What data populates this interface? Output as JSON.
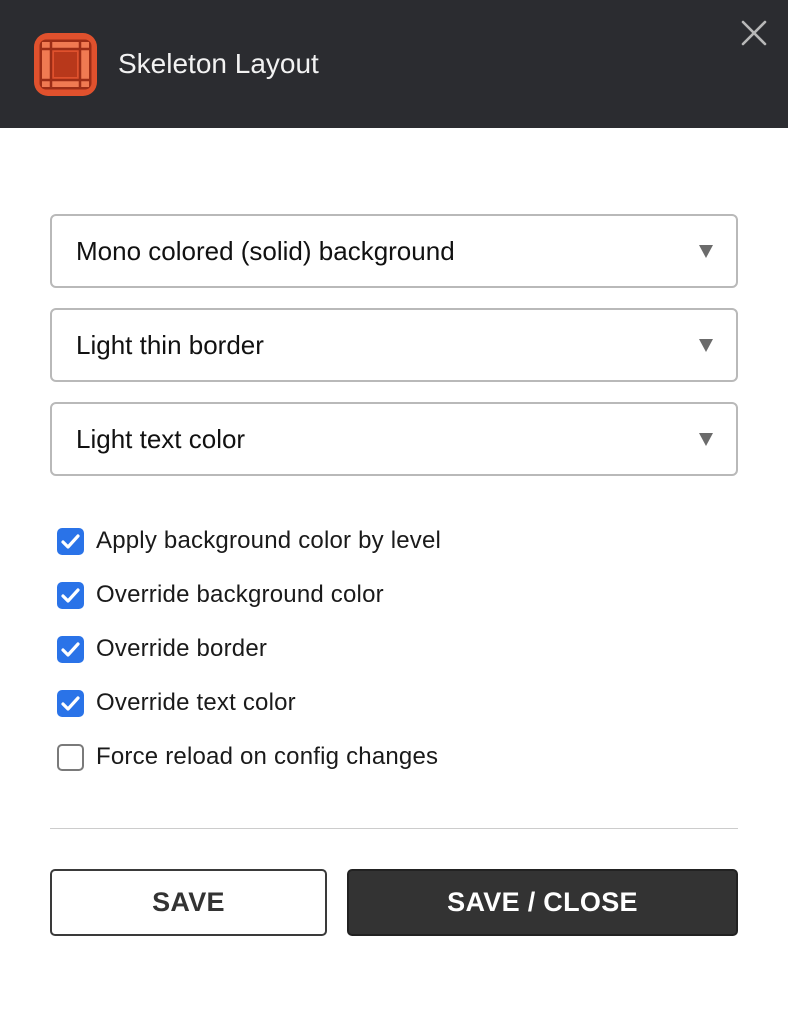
{
  "header": {
    "title": "Skeleton Layout",
    "logo_icon": "grid-layout-icon",
    "close_icon": "close-icon"
  },
  "selects": [
    {
      "value": "Mono colored (solid) background"
    },
    {
      "value": "Light thin border"
    },
    {
      "value": "Light text color"
    }
  ],
  "options": [
    {
      "label": "Apply background color by level",
      "checked": true
    },
    {
      "label": "Override background color",
      "checked": true
    },
    {
      "label": "Override border",
      "checked": true
    },
    {
      "label": "Override text color",
      "checked": true
    },
    {
      "label": "Force reload on config changes",
      "checked": false
    }
  ],
  "buttons": {
    "save_label": "SAVE",
    "save_close_label": "SAVE / CLOSE"
  },
  "colors": {
    "header_bg": "#2b2c30",
    "logo_accent": "#e0512d",
    "checkbox_on": "#2a73e8",
    "primary_button": "#333333"
  }
}
